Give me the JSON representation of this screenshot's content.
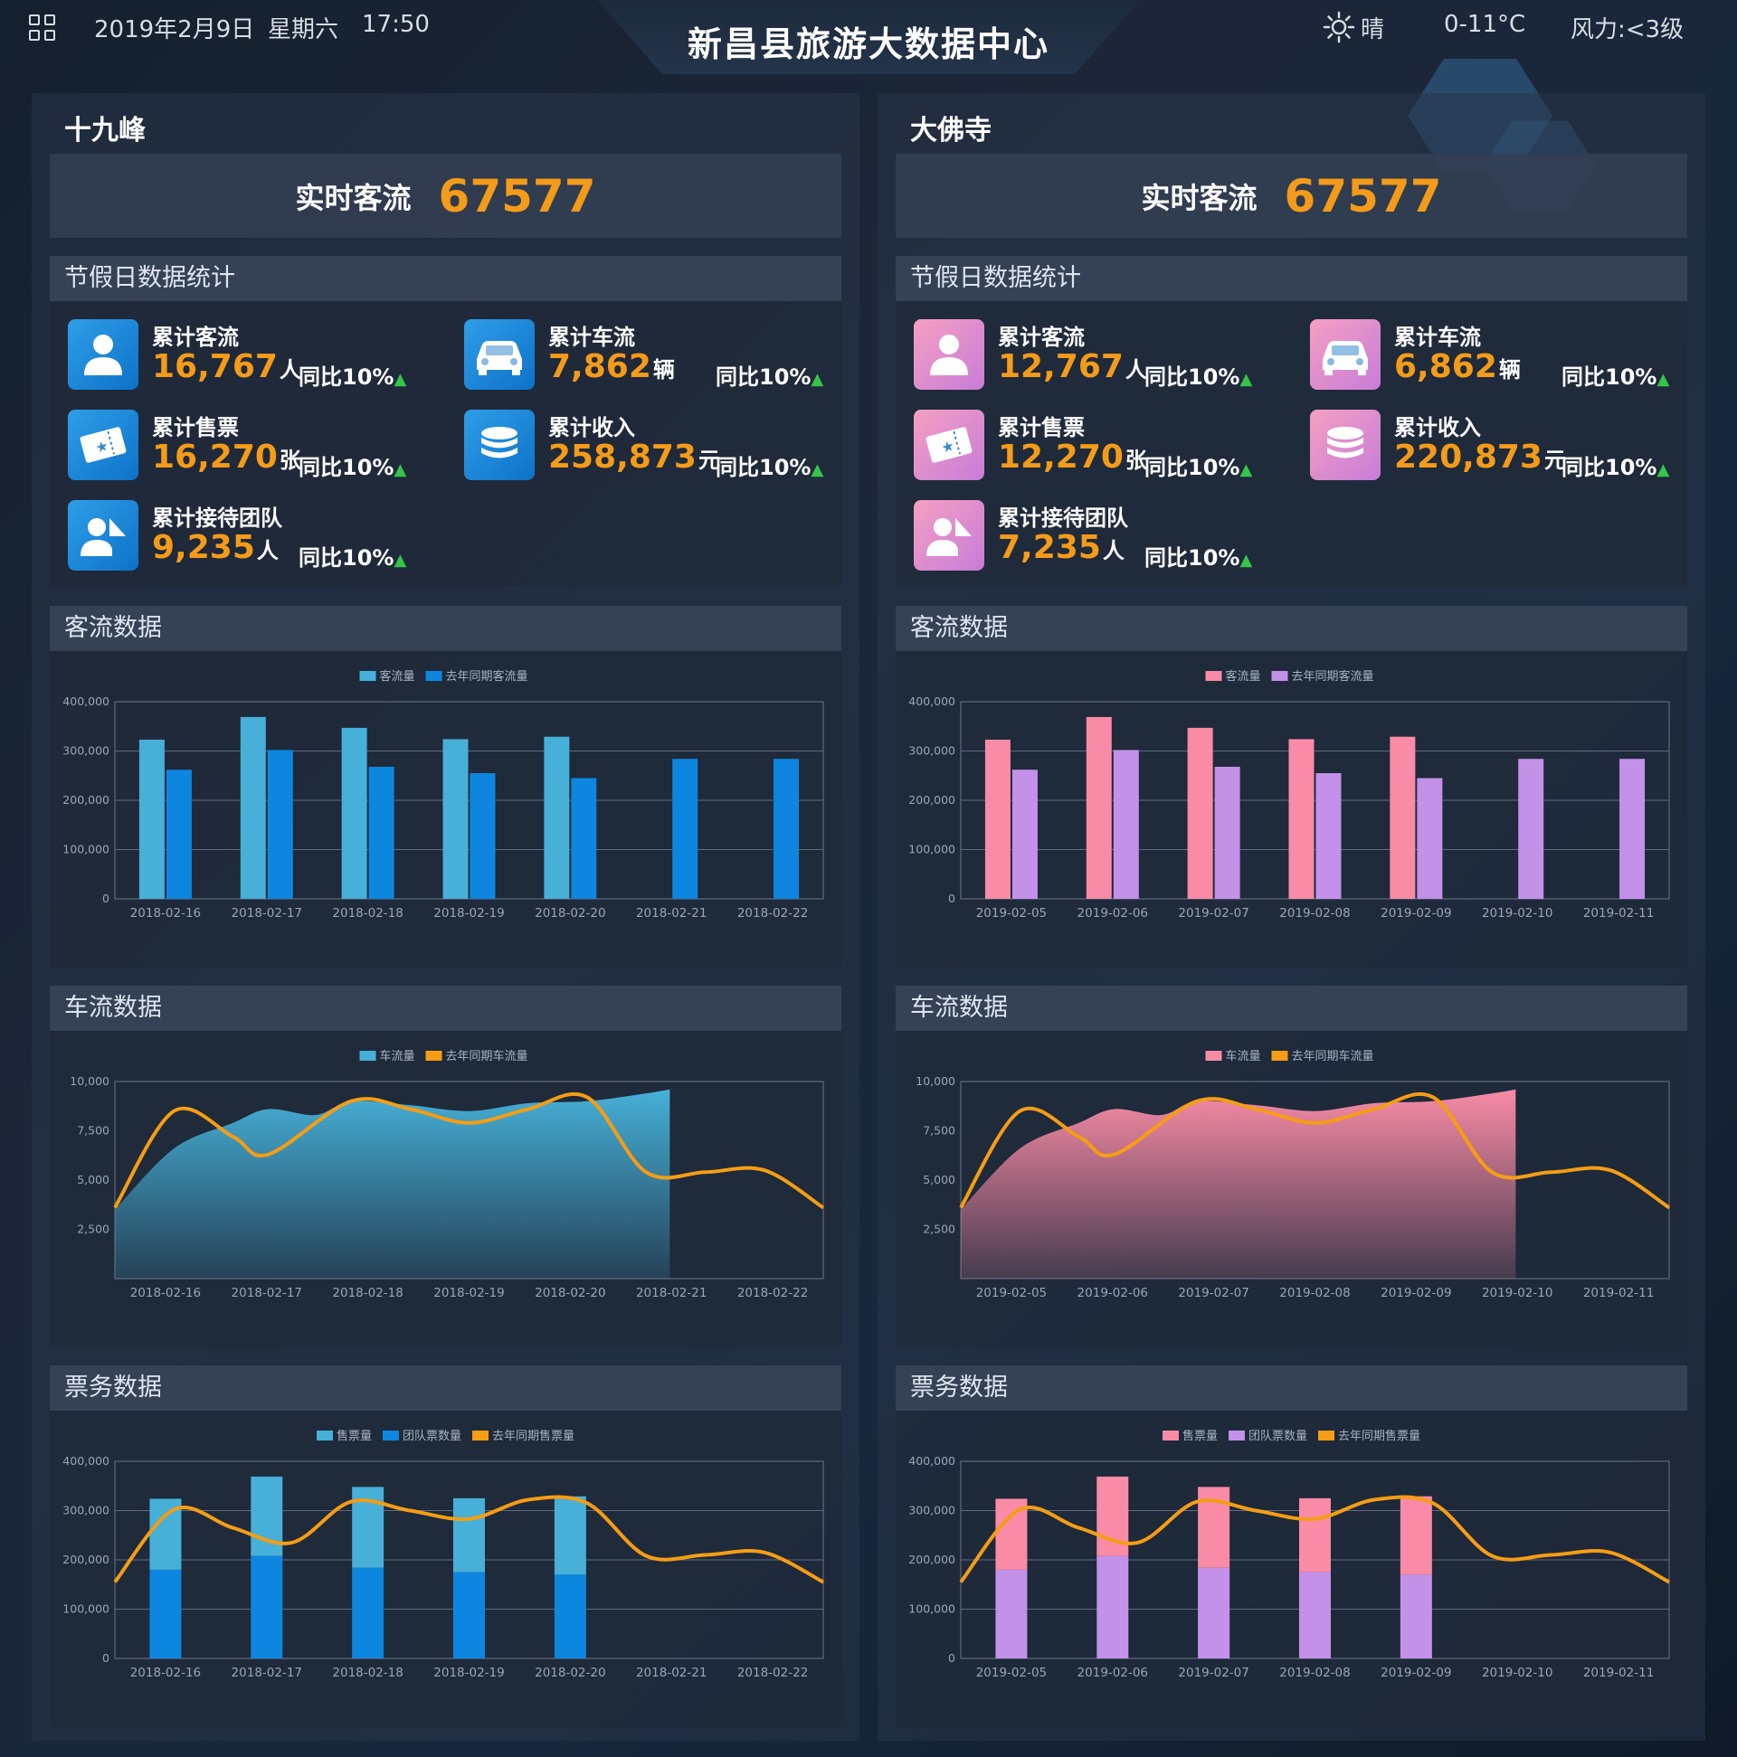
{
  "header": {
    "date": "2019年2月9日",
    "weekday": "星期六",
    "time": "17:50",
    "title": "新昌县旅游大数据中心",
    "weather": "晴",
    "temperature": "0-11°C",
    "wind": "风力:<3级"
  },
  "labels": {
    "realtime_flow": "实时客流",
    "holiday_stats": "节假日数据统计",
    "visitor_section": "客流数据",
    "vehicle_section": "车流数据",
    "ticket_section": "票务数据",
    "visitor_legend": [
      "客流量",
      "去年同期客流量"
    ],
    "vehicle_legend": [
      "车流量",
      "去年同期车流量"
    ],
    "ticket_legend": [
      "售票量",
      "团队票数量",
      "去年同期售票量"
    ]
  },
  "panels": [
    {
      "name": "十九峰",
      "theme": "blue",
      "realtime_flow": "67577",
      "colors": {
        "primary": "#46b0d8",
        "secondary": "#0d86e0",
        "line": "#f59d14"
      },
      "stats": [
        {
          "label": "累计客流",
          "value": "16,767",
          "unit": "人",
          "yoy": "同比10%",
          "icon": "person-icon"
        },
        {
          "label": "累计车流",
          "value": "7,862",
          "unit": "辆",
          "yoy": "同比10%",
          "icon": "car-icon"
        },
        {
          "label": "累计售票",
          "value": "16,270",
          "unit": "张",
          "yoy": "同比10%",
          "icon": "ticket-icon"
        },
        {
          "label": "累计收入",
          "value": "258,873",
          "unit": "元",
          "yoy": "同比10%",
          "icon": "coins-icon"
        },
        {
          "label": "累计接待团队",
          "value": "9,235",
          "unit": "人",
          "yoy": "同比10%",
          "icon": "team-icon"
        }
      ]
    },
    {
      "name": "大佛寺",
      "theme": "pink",
      "realtime_flow": "67577",
      "colors": {
        "primary": "#f98ba6",
        "secondary": "#c391e8",
        "line": "#f59d14"
      },
      "stats": [
        {
          "label": "累计客流",
          "value": "12,767",
          "unit": "人",
          "yoy": "同比10%",
          "icon": "person-icon"
        },
        {
          "label": "累计车流",
          "value": "6,862",
          "unit": "辆",
          "yoy": "同比10%",
          "icon": "car-icon"
        },
        {
          "label": "累计售票",
          "value": "12,270",
          "unit": "张",
          "yoy": "同比10%",
          "icon": "ticket-icon"
        },
        {
          "label": "累计收入",
          "value": "220,873",
          "unit": "元",
          "yoy": "同比10%",
          "icon": "coins-icon"
        },
        {
          "label": "累计接待团队",
          "value": "7,235",
          "unit": "人",
          "yoy": "同比10%",
          "icon": "team-icon"
        }
      ]
    }
  ],
  "chart_data": [
    {
      "panel": "十九峰",
      "section": "客流数据",
      "type": "bar",
      "categories": [
        "2018-02-16",
        "2018-02-17",
        "2018-02-18",
        "2018-02-19",
        "2018-02-20",
        "2018-02-21",
        "2018-02-22"
      ],
      "series": [
        {
          "name": "客流量",
          "values": [
            323000,
            369000,
            347000,
            324000,
            329000,
            null,
            null
          ]
        },
        {
          "name": "去年同期客流量",
          "values": [
            262000,
            302000,
            268000,
            255000,
            245000,
            284000,
            284000
          ]
        }
      ],
      "ylim": [
        0,
        400000
      ],
      "yticks": [
        "0",
        "100,000",
        "200,000",
        "300,000",
        "400,000"
      ],
      "grid": true,
      "legend": "top-center"
    },
    {
      "panel": "十九峰",
      "section": "车流数据",
      "type": "area",
      "categories": [
        "2018-02-16",
        "2018-02-17",
        "2018-02-18",
        "2018-02-19",
        "2018-02-20",
        "2018-02-21",
        "2018-02-22"
      ],
      "series": [
        {
          "name": "车流量",
          "type": "area",
          "x": [
            0,
            0.5,
            1,
            1.3,
            1.7,
            2,
            2.5,
            3,
            3.5,
            4,
            4.5,
            4.7
          ],
          "values": [
            3500,
            6600,
            7900,
            8600,
            8300,
            9000,
            8800,
            8500,
            8900,
            9000,
            9400,
            9600
          ]
        },
        {
          "name": "去年同期车流量",
          "type": "line",
          "x": [
            0,
            0.5,
            1,
            1.3,
            2,
            2.5,
            3,
            3.5,
            4,
            4.5,
            5,
            5.5,
            6
          ],
          "values": [
            3600,
            8500,
            7200,
            6300,
            9000,
            8600,
            7900,
            8600,
            9200,
            5400,
            5400,
            5500,
            3600
          ]
        }
      ],
      "ylim": [
        0,
        10000
      ],
      "yticks": [
        "2,500",
        "5,000",
        "7,500",
        "10,000"
      ],
      "grid": false,
      "legend": "top-center"
    },
    {
      "panel": "十九峰",
      "section": "票务数据",
      "type": "bar",
      "categories": [
        "2018-02-16",
        "2018-02-17",
        "2018-02-18",
        "2018-02-19",
        "2018-02-20",
        "2018-02-21",
        "2018-02-22"
      ],
      "series": [
        {
          "name": "售票量",
          "stack": "t",
          "values": [
            144000,
            161000,
            164000,
            150000,
            159000,
            null,
            null
          ]
        },
        {
          "name": "团队票数量",
          "stack": "t",
          "values": [
            180000,
            208000,
            184000,
            175000,
            170000,
            null,
            null
          ]
        },
        {
          "name": "去年同期售票量",
          "type": "line",
          "x": [
            0,
            0.5,
            1,
            1.5,
            2,
            2.5,
            3,
            3.5,
            4,
            4.5,
            5,
            5.5,
            6
          ],
          "values": [
            155000,
            302000,
            265000,
            235000,
            318000,
            300000,
            283000,
            322000,
            315000,
            208000,
            210000,
            215000,
            155000
          ]
        }
      ],
      "ylim": [
        0,
        400000
      ],
      "yticks": [
        "0",
        "100,000",
        "200,000",
        "300,000",
        "400,000"
      ],
      "grid": true,
      "legend": "top-center"
    },
    {
      "panel": "大佛寺",
      "section": "客流数据",
      "type": "bar",
      "categories": [
        "2019-02-05",
        "2019-02-06",
        "2019-02-07",
        "2019-02-08",
        "2019-02-09",
        "2019-02-10",
        "2019-02-11"
      ],
      "series": [
        {
          "name": "客流量",
          "values": [
            323000,
            369000,
            347000,
            324000,
            329000,
            null,
            null
          ]
        },
        {
          "name": "去年同期客流量",
          "values": [
            262000,
            302000,
            268000,
            255000,
            245000,
            284000,
            284000
          ]
        }
      ],
      "ylim": [
        0,
        400000
      ],
      "yticks": [
        "0",
        "100,000",
        "200,000",
        "300,000",
        "400,000"
      ],
      "grid": true,
      "legend": "top-center"
    },
    {
      "panel": "大佛寺",
      "section": "车流数据",
      "type": "area",
      "categories": [
        "2019-02-05",
        "2019-02-06",
        "2019-02-07",
        "2019-02-08",
        "2019-02-09",
        "2019-02-10",
        "2019-02-11"
      ],
      "series": [
        {
          "name": "车流量",
          "type": "area",
          "x": [
            0,
            0.5,
            1,
            1.3,
            1.7,
            2,
            2.5,
            3,
            3.5,
            4,
            4.5,
            4.7
          ],
          "values": [
            3500,
            6600,
            7900,
            8600,
            8300,
            9000,
            8800,
            8500,
            8900,
            9000,
            9400,
            9600
          ]
        },
        {
          "name": "去年同期车流量",
          "type": "line",
          "x": [
            0,
            0.5,
            1,
            1.3,
            2,
            2.5,
            3,
            3.5,
            4,
            4.5,
            5,
            5.5,
            6
          ],
          "values": [
            3600,
            8500,
            7200,
            6300,
            9000,
            8600,
            7900,
            8600,
            9200,
            5400,
            5400,
            5500,
            3600
          ]
        }
      ],
      "ylim": [
        0,
        10000
      ],
      "yticks": [
        "2,500",
        "5,000",
        "7,500",
        "10,000"
      ],
      "grid": false,
      "legend": "top-center"
    },
    {
      "panel": "大佛寺",
      "section": "票务数据",
      "type": "bar",
      "categories": [
        "2019-02-05",
        "2019-02-06",
        "2019-02-07",
        "2019-02-08",
        "2019-02-09",
        "2019-02-10",
        "2019-02-11"
      ],
      "series": [
        {
          "name": "售票量",
          "stack": "t",
          "values": [
            144000,
            161000,
            164000,
            150000,
            159000,
            null,
            null
          ]
        },
        {
          "name": "团队票数量",
          "stack": "t",
          "values": [
            180000,
            208000,
            184000,
            175000,
            170000,
            null,
            null
          ]
        },
        {
          "name": "去年同期售票量",
          "type": "line",
          "x": [
            0,
            0.5,
            1,
            1.5,
            2,
            2.5,
            3,
            3.5,
            4,
            4.5,
            5,
            5.5,
            6
          ],
          "values": [
            155000,
            302000,
            265000,
            235000,
            318000,
            300000,
            283000,
            322000,
            315000,
            208000,
            210000,
            215000,
            155000
          ]
        }
      ],
      "ylim": [
        0,
        400000
      ],
      "yticks": [
        "0",
        "100,000",
        "200,000",
        "300,000",
        "400,000"
      ],
      "grid": true,
      "legend": "top-center"
    }
  ]
}
